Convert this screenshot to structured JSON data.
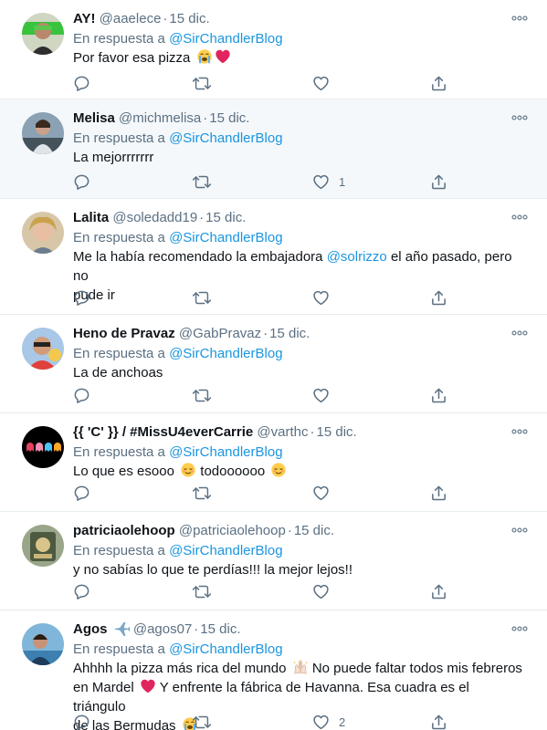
{
  "reply_prefix": "En respuesta a",
  "tweets": [
    {
      "name": "AY!",
      "handle": "@aaelece",
      "date": "15 dic.",
      "reply_to": "@SirChandlerBlog",
      "text": "Por favor esa pizza",
      "likes": "",
      "avatar": "avatar-aaelece"
    },
    {
      "name": "Melisa",
      "handle": "@michmelisa",
      "date": "15 dic.",
      "reply_to": "@SirChandlerBlog",
      "text": "La mejorrrrrrr",
      "likes": "1",
      "avatar": "avatar-michmelisa"
    },
    {
      "name": "Lalita",
      "handle": "@soledadd19",
      "date": "15 dic.",
      "reply_to": "@SirChandlerBlog",
      "text_a": "Me la había recomendado la embajadora",
      "mention": "@solrizzo",
      "text_b": "el año pasado, pero no",
      "text_c": "pude ir",
      "likes": "",
      "avatar": "avatar-soledadd19"
    },
    {
      "name": "Heno de Pravaz",
      "handle": "@GabPravaz",
      "date": "15 dic.",
      "reply_to": "@SirChandlerBlog",
      "text": "La de anchoas",
      "likes": "",
      "avatar": "avatar-gabpravaz"
    },
    {
      "name": "{{ 'C' }} / #MissU4everCarrie",
      "handle": "@varthc",
      "date": "15 dic.",
      "reply_to": "@SirChandlerBlog",
      "text_a": "Lo que es esooo",
      "text_b": "todoooooo",
      "likes": "",
      "avatar": "avatar-varthc"
    },
    {
      "name": "patriciaolehoop",
      "handle": "@patriciaolehoop",
      "date": "15 dic.",
      "reply_to": "@SirChandlerBlog",
      "text": "y no sabías lo que te perdías!!! la mejor lejos!!",
      "likes": "",
      "avatar": "avatar-patriciaolehoop"
    },
    {
      "name": "Agos",
      "handle": "@agos07",
      "date": "15 dic.",
      "reply_to": "@SirChandlerBlog",
      "line1_a": "Ahhhh la pizza más rica del mundo",
      "line1_b": "No puede faltar todos mis febreros",
      "line2_a": "en Mardel",
      "line2_b": "Y enfrente la fábrica de Havanna. Esa cuadra es el triángulo",
      "line3": "de las Bermudas",
      "likes": "2",
      "avatar": "avatar-agos07"
    }
  ],
  "colors": {
    "link": "#1b95e0",
    "muted": "#5b7083",
    "highlight_bg": "#f5f8fa",
    "divider": "#e6ecf0"
  },
  "icons": [
    "more-icon",
    "reply-icon",
    "retweet-icon",
    "like-icon",
    "share-icon",
    "airplane-icon",
    "heart-emoji",
    "crying-emoji",
    "relieved-emoji",
    "raised-hands-emoji"
  ]
}
